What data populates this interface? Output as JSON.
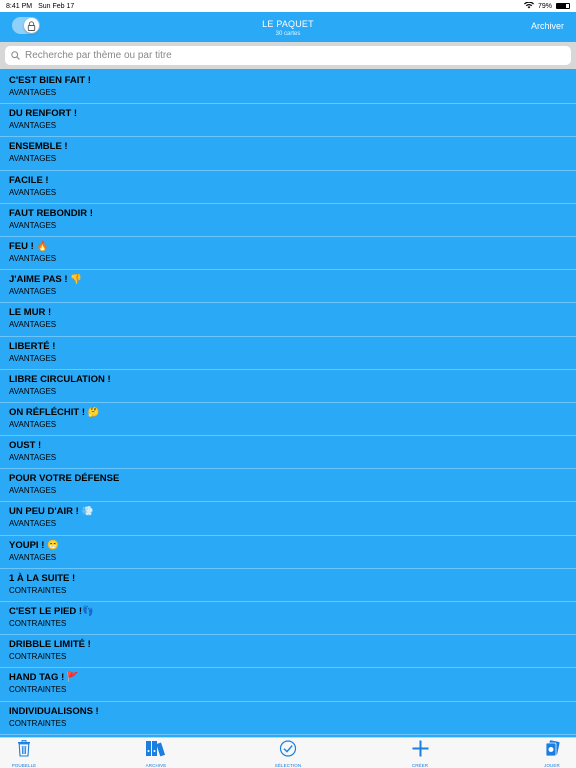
{
  "status": {
    "time": "8:41 PM",
    "date": "Sun Feb 17",
    "battery": "79%",
    "battery_level": 0.79
  },
  "nav": {
    "title": "LE PAQUET",
    "subtitle": "30 cartes",
    "archive": "Archiver"
  },
  "search": {
    "placeholder": "Recherche par thème ou par titre",
    "value": ""
  },
  "items": [
    {
      "title": "C'EST BIEN FAIT !",
      "category": "AVANTAGES"
    },
    {
      "title": "DU RENFORT !",
      "category": "AVANTAGES"
    },
    {
      "title": "ENSEMBLE !",
      "category": "AVANTAGES"
    },
    {
      "title": "FACILE !",
      "category": "AVANTAGES"
    },
    {
      "title": "FAUT REBONDIR !",
      "category": "AVANTAGES"
    },
    {
      "title": "FEU ! 🔥",
      "category": "AVANTAGES"
    },
    {
      "title": "J'AIME PAS ! 👎",
      "category": "AVANTAGES"
    },
    {
      "title": "LE MUR !",
      "category": "AVANTAGES"
    },
    {
      "title": "LIBERTÉ !",
      "category": "AVANTAGES"
    },
    {
      "title": "LIBRE CIRCULATION !",
      "category": "AVANTAGES"
    },
    {
      "title": "ON RÉFLÉCHIT ! 🤔",
      "category": "AVANTAGES"
    },
    {
      "title": "OUST !",
      "category": "AVANTAGES"
    },
    {
      "title": "POUR VOTRE DÉFENSE",
      "category": "AVANTAGES"
    },
    {
      "title": "UN PEU D'AIR ! 💨",
      "category": "AVANTAGES"
    },
    {
      "title": "YOUPI ! 😁",
      "category": "AVANTAGES"
    },
    {
      "title": "1 À LA SUITE !",
      "category": "CONTRAINTES"
    },
    {
      "title": "C'EST LE PIED !👣",
      "category": "CONTRAINTES"
    },
    {
      "title": "DRIBBLE LIMITÉ !",
      "category": "CONTRAINTES"
    },
    {
      "title": "HAND TAG ! 🚩",
      "category": "CONTRAINTES"
    },
    {
      "title": "INDIVIDUALISONS !",
      "category": "CONTRAINTES"
    }
  ],
  "tabs": [
    {
      "label": "POUBELLE",
      "icon": "trash-icon"
    },
    {
      "label": "ARCHIVE",
      "icon": "binders-icon"
    },
    {
      "label": "SÉLECTION",
      "icon": "checkmark-circle-icon"
    },
    {
      "label": "CRÉER",
      "icon": "plus-icon"
    },
    {
      "label": "JOUER",
      "icon": "cards-icon"
    }
  ],
  "colors": {
    "background": "#2aa9f7",
    "tint": "#1a7fe0"
  }
}
